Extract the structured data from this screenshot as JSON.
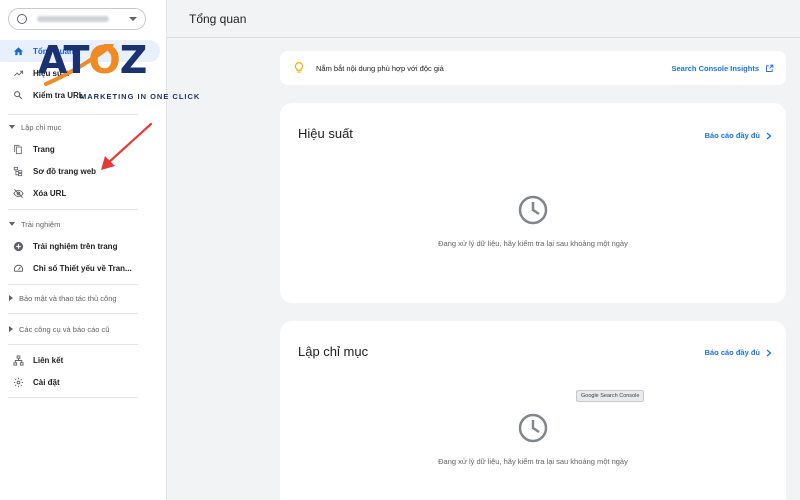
{
  "sidebar": {
    "property_value": "",
    "items_top": [
      {
        "label": "Tổng quan",
        "icon": "home-icon"
      },
      {
        "label": "Hiệu suất",
        "icon": "trending-up-icon"
      },
      {
        "label": "Kiểm tra URL",
        "icon": "search-icon"
      }
    ],
    "section_indexing": "Lập chỉ mục",
    "items_indexing": [
      {
        "label": "Trang",
        "icon": "pages-icon"
      },
      {
        "label": "Sơ đồ trang web",
        "icon": "sitemap-icon"
      },
      {
        "label": "Xóa URL",
        "icon": "eye-off-icon"
      }
    ],
    "section_experience": "Trải nghiệm",
    "items_experience": [
      {
        "label": "Trải nghiệm trên trang",
        "icon": "plus-circle-icon"
      },
      {
        "label": "Chỉ số Thiết yếu về Tran...",
        "icon": "gauge-icon"
      }
    ],
    "section_security": "Bảo mật và thao tác thủ công",
    "section_legacy": "Các công cụ và báo cáo cũ",
    "items_bottom": [
      {
        "label": "Liên kết",
        "icon": "links-icon"
      },
      {
        "label": "Cài đặt",
        "icon": "gear-icon"
      }
    ]
  },
  "logo": {
    "text": "ATOZ",
    "tagline": "MARKETING IN ONE CLICK"
  },
  "header": {
    "title": "Tổng quan"
  },
  "insight": {
    "message": "Nắm bắt nội dung phù hợp với độc giả",
    "link_label": "Search Console Insights"
  },
  "cards": [
    {
      "title": "Hiệu suất",
      "link_label": "Báo cáo đầy đủ",
      "empty_message": "Đang xử lý dữ liệu, hãy kiểm tra lại sau khoảng một ngày"
    },
    {
      "title": "Lập chỉ mục",
      "link_label": "Báo cáo đầy đủ",
      "empty_message": "Đang xử lý dữ liệu, hãy kiểm tra lại sau khoảng một ngày"
    }
  ],
  "tooltip": "Google Search Console",
  "colors": {
    "accent": "#1a73e8",
    "active_bg": "#e8f0fe",
    "logo_blue": "#1a3272",
    "logo_orange": "#f08a24",
    "arrow_red": "#e53935",
    "bulb_yellow": "#f9ab00"
  }
}
